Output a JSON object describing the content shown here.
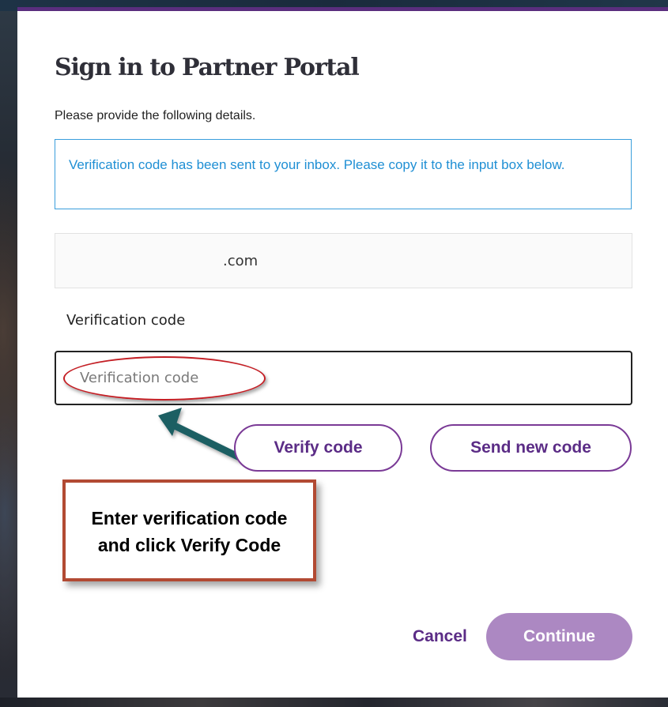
{
  "page": {
    "title": "Sign in to Partner Portal",
    "intro": "Please provide the following details."
  },
  "notice": {
    "text": "Verification code has been sent to your inbox. Please copy it to the input box below."
  },
  "form": {
    "email_value": ".com",
    "code_label": "Verification code",
    "code_placeholder": "Verification code",
    "verify_label": "Verify code",
    "send_new_label": "Send new code"
  },
  "annotation": {
    "callout_line1": "Enter verification code",
    "callout_line2": "and click Verify Code",
    "ellipse_color": "#c41e24",
    "arrow_color": "#1e5e63",
    "callout_border_color": "#b24a33"
  },
  "actions": {
    "cancel_label": "Cancel",
    "continue_label": "Continue"
  },
  "colors": {
    "brand_purple": "#5b2c86",
    "continue_bg": "#ac88c2",
    "info_blue": "#1f8fd4"
  }
}
